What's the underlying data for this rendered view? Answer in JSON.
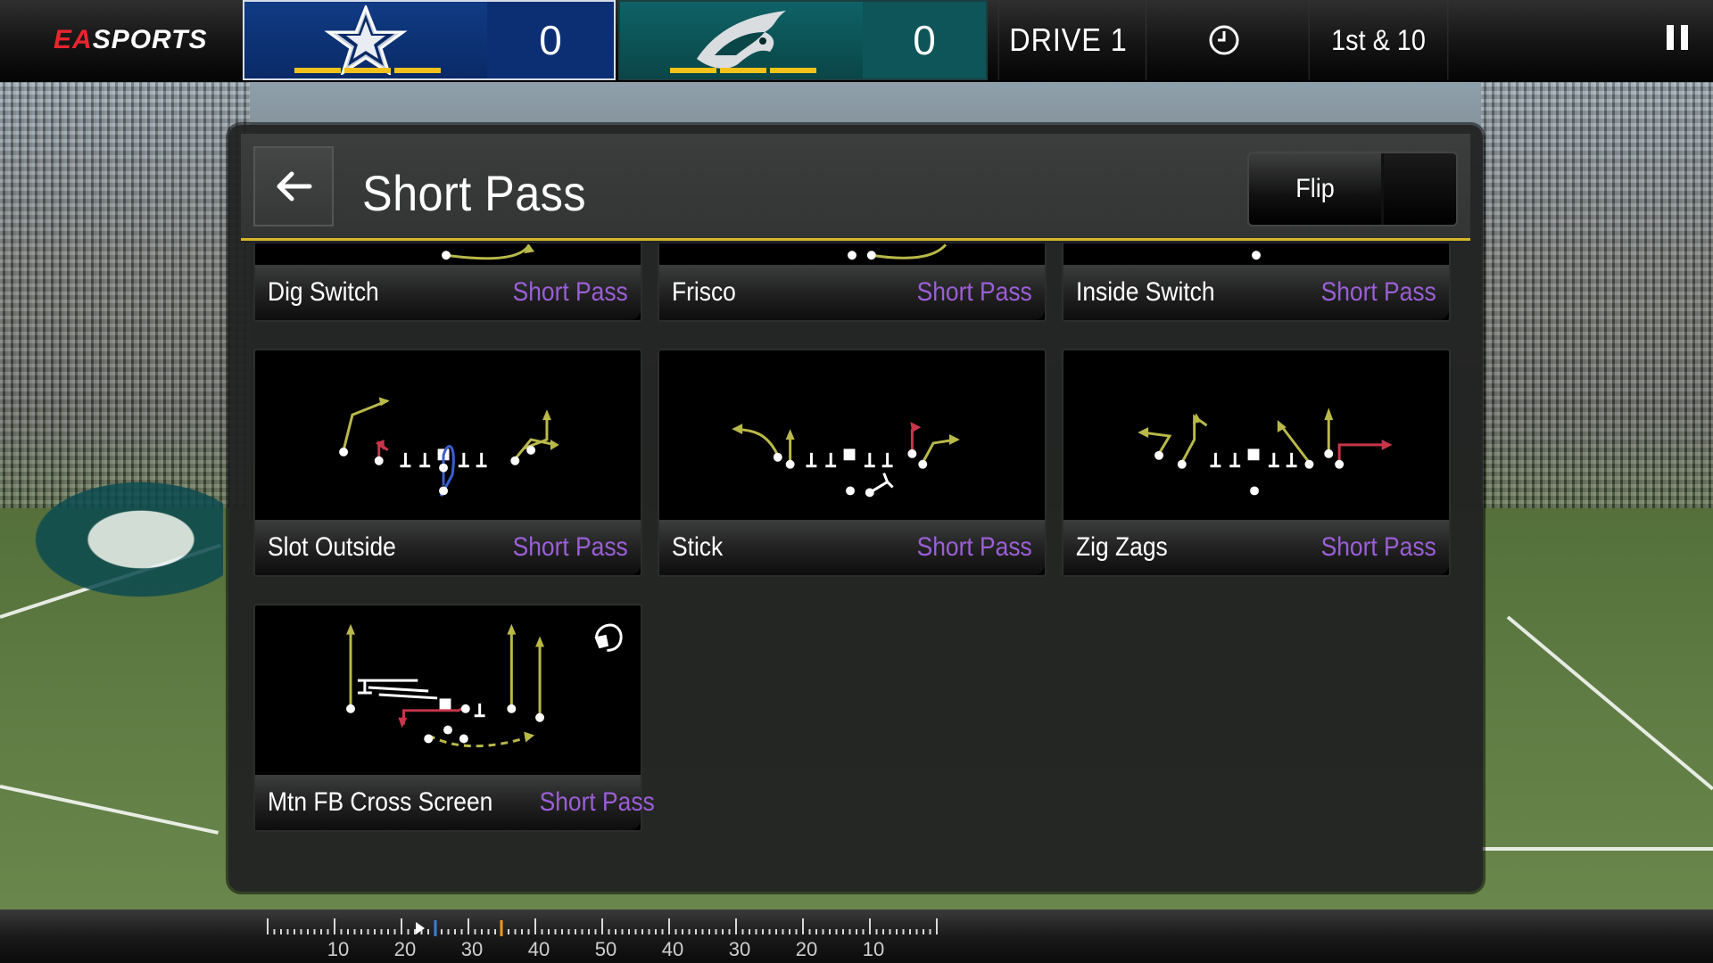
{
  "brand": {
    "ea": "EA",
    "sports": "SPORTS"
  },
  "scoreboard": {
    "home": {
      "team_icon": "cowboys-star-icon",
      "score": "0",
      "color": "#0a2a66",
      "timeouts_remaining": 3
    },
    "away": {
      "team_icon": "eagles-head-icon",
      "score": "0",
      "color": "#0c4f52",
      "timeouts_remaining": 3
    },
    "drive": "DRIVE 1",
    "clock_icon": "clock-icon",
    "down_distance": "1st & 10",
    "pause_icon": "pause-icon"
  },
  "panel": {
    "title": "Short Pass",
    "back_icon": "arrow-left-icon",
    "flip_label": "Flip",
    "accent_color": "#d8b62a"
  },
  "plays": [
    {
      "name": "Dig Switch",
      "type": "Short Pass"
    },
    {
      "name": "Frisco",
      "type": "Short Pass"
    },
    {
      "name": "Inside Switch",
      "type": "Short Pass"
    },
    {
      "name": "Slot Outside",
      "type": "Short Pass"
    },
    {
      "name": "Stick",
      "type": "Short Pass"
    },
    {
      "name": "Zig Zags",
      "type": "Short Pass"
    },
    {
      "name": "Mtn FB Cross Screen",
      "type": "Short Pass",
      "badge_icon": "headset-icon"
    }
  ],
  "play_type_color": "#9b5fd6",
  "yard_markers": [
    "10",
    "20",
    "30",
    "40",
    "50",
    "40",
    "30",
    "20",
    "10"
  ]
}
